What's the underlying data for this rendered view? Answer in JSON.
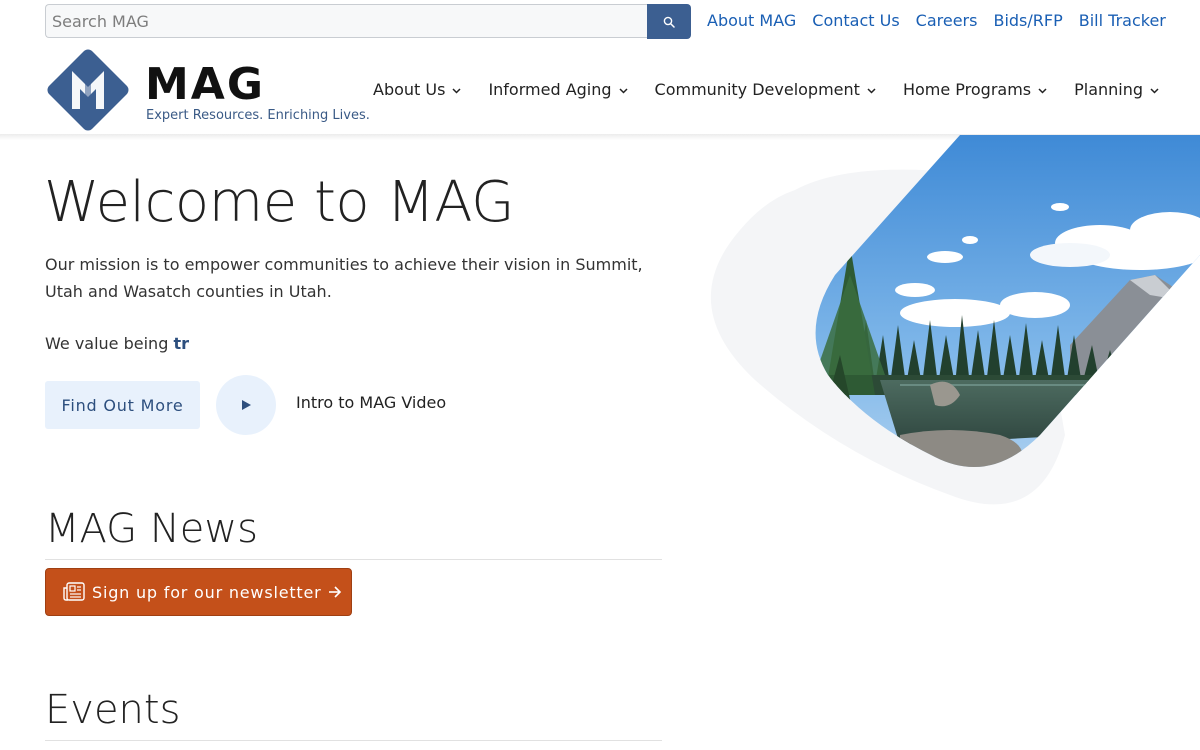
{
  "search": {
    "placeholder": "Search MAG",
    "value": ""
  },
  "utility_links": [
    "About MAG",
    "Contact Us",
    "Careers",
    "Bids/RFP",
    "Bill Tracker"
  ],
  "logo": {
    "name": "MAG",
    "tagline": "Expert Resources. Enriching Lives."
  },
  "nav": [
    "About Us",
    "Informed Aging",
    "Community Development",
    "Home Programs",
    "Planning"
  ],
  "hero": {
    "title": "Welcome to MAG",
    "mission": "Our mission is to empower communities to achieve their vision in Summit, Utah and Wasatch counties in Utah.",
    "values_prefix": "We value being ",
    "values_typed": "tr",
    "find_out_more": "Find Out More",
    "video_label": "Intro to MAG Video"
  },
  "news": {
    "title": "MAG News",
    "newsletter_button": "Sign up for our newsletter"
  },
  "events": {
    "title": "Events"
  },
  "icons": {
    "search": "search-icon",
    "chevron": "chevron-down-icon",
    "play": "play-icon",
    "newspaper": "newspaper-icon",
    "arrow": "arrow-right-icon"
  },
  "colors": {
    "brand_blue": "#3c5f91",
    "link_blue": "#1a5fb4",
    "accent_orange": "#c4501a",
    "light_blue_bg": "#e8f1fc"
  }
}
